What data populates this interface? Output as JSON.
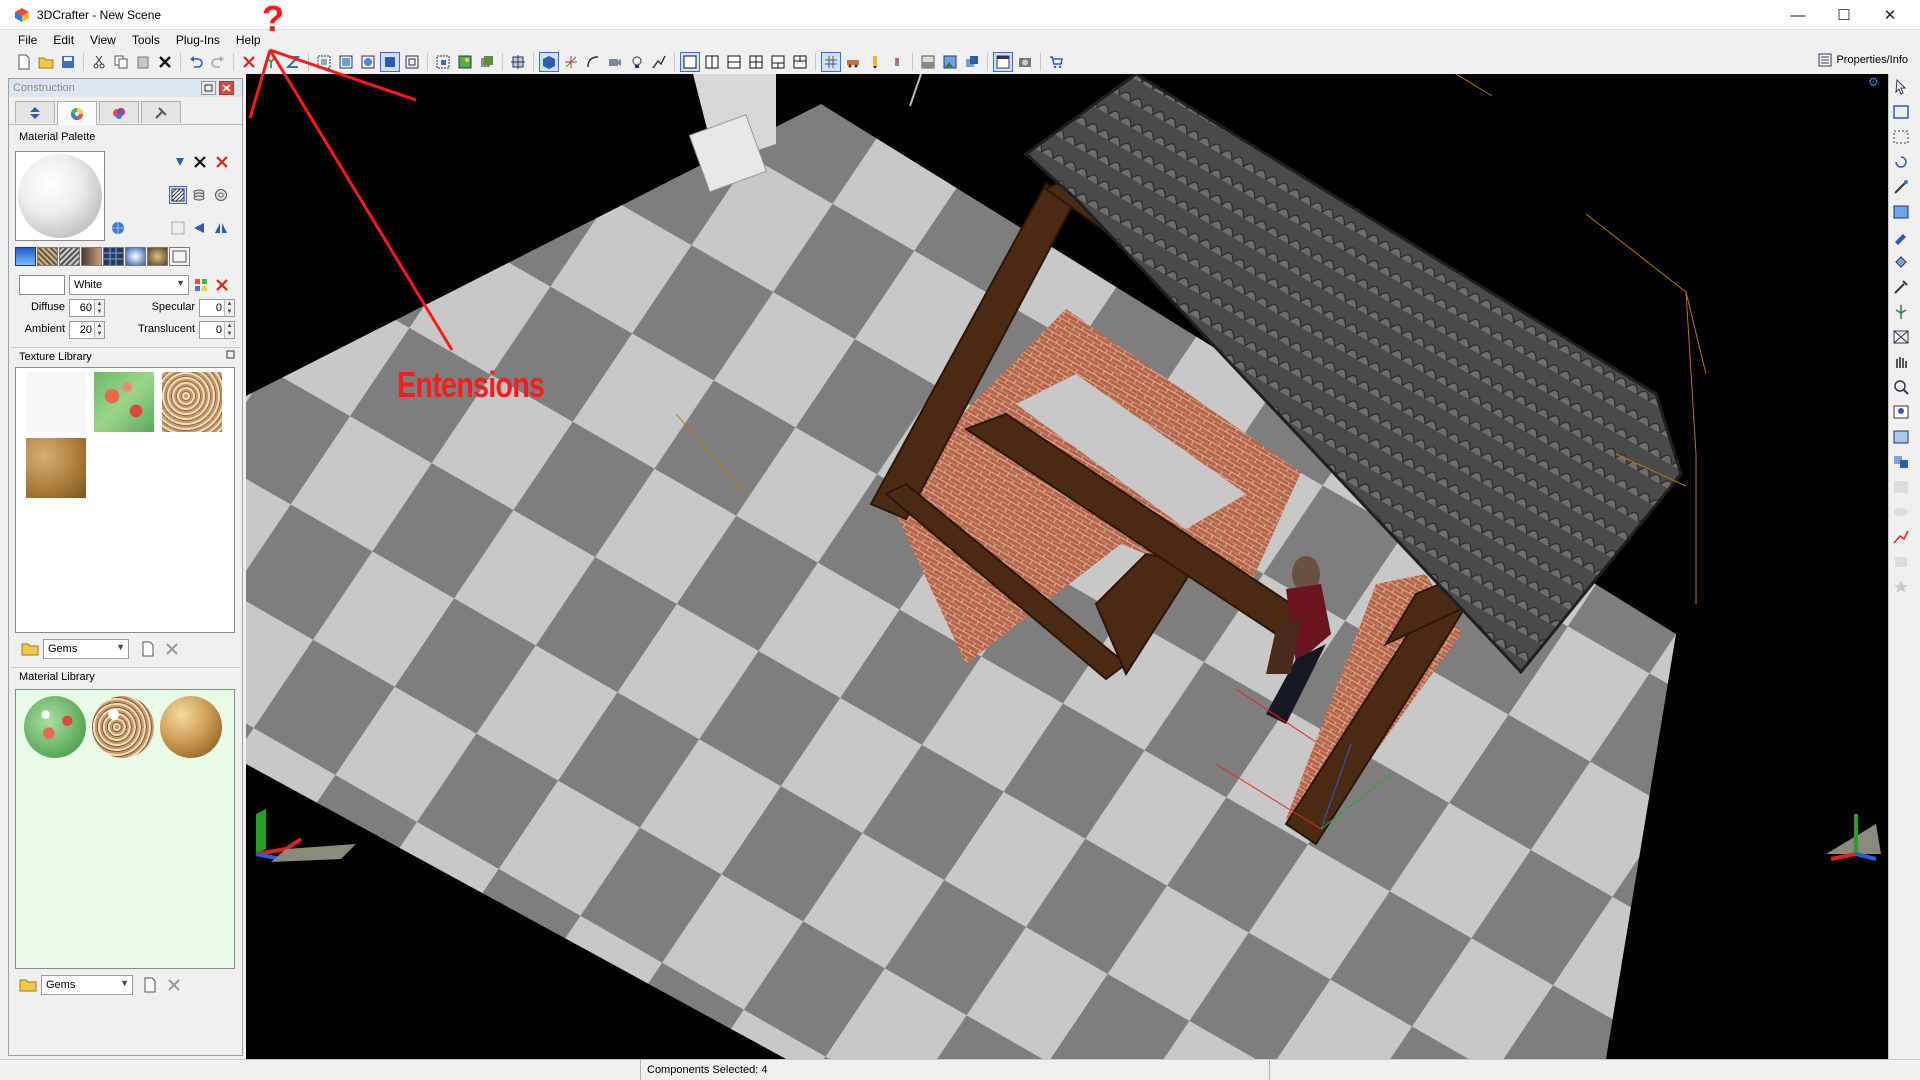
{
  "window": {
    "title": "3DCrafter - New Scene",
    "minimize": "—",
    "maximize": "☐",
    "close": "✕"
  },
  "menu": [
    "File",
    "Edit",
    "View",
    "Tools",
    "Plug-Ins",
    "Help"
  ],
  "toolbar": {
    "properties_label": "Properties/Info"
  },
  "left_panel": {
    "header": "Construction",
    "tabs": [
      "assembly-tab",
      "materials-tab",
      "painting-tab",
      "tools-tab"
    ],
    "material_palette": {
      "label": "Material Palette",
      "color_name": "White",
      "diffuse_label": "Diffuse",
      "diffuse": "60",
      "ambient_label": "Ambient",
      "ambient": "20",
      "specular_label": "Specular",
      "specular": "0",
      "translucent_label": "Translucent",
      "translucent": "0"
    },
    "texture_library": {
      "label": "Texture Library",
      "category": "Gems"
    },
    "material_library": {
      "label": "Material Library",
      "category": "Gems"
    }
  },
  "status": {
    "components_selected": "Components Selected: 4"
  },
  "annotation": {
    "label": "Entensions",
    "mark": "?"
  },
  "colors": {
    "annotation": "#ff1a1a",
    "panel_bg": "#f0f0f0",
    "material_library_bg": "#e8fbe6",
    "viewport_bg": "#000000"
  }
}
